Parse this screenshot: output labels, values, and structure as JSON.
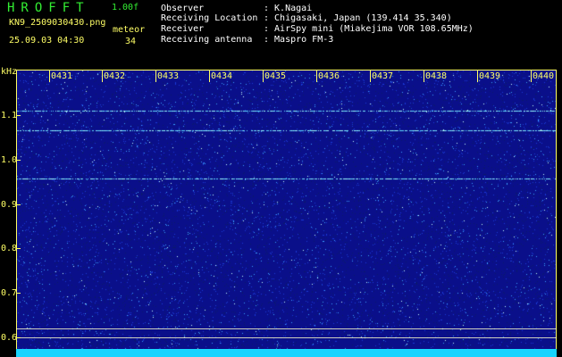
{
  "header": {
    "app_title": "HROFFT",
    "version": "1.00f",
    "filename": "KN9_2509030430.png",
    "meteor_label": "meteor",
    "datetime": "25.09.03 04:30",
    "meteor_count": "34",
    "info_rows": [
      {
        "key": "Observer",
        "value": ": K.Nagai"
      },
      {
        "key": "Receiving Location",
        "value": ": Chigasaki, Japan (139.414 35.340)"
      },
      {
        "key": "Receiver",
        "value": ": AirSpy mini (Miakejima VOR 108.65MHz)"
      },
      {
        "key": "Receiving antenna",
        "value": ": Maspro FM-3"
      }
    ]
  },
  "axes": {
    "y_unit": "kHz",
    "y_ticks": [
      "1.1",
      "1.0",
      "0.9",
      "0.8",
      "0.7",
      "0.6"
    ],
    "x_ticks": [
      "0431",
      "0432",
      "0433",
      "0434",
      "0435",
      "0436",
      "0437",
      "0438",
      "0439",
      "0440"
    ]
  },
  "colors": {
    "background": "#000000",
    "spectrogram": "#0a0f8a",
    "label_yellow": "#ffff66",
    "label_green": "#33ee33",
    "signal_cyan": "#9ffcff"
  }
}
